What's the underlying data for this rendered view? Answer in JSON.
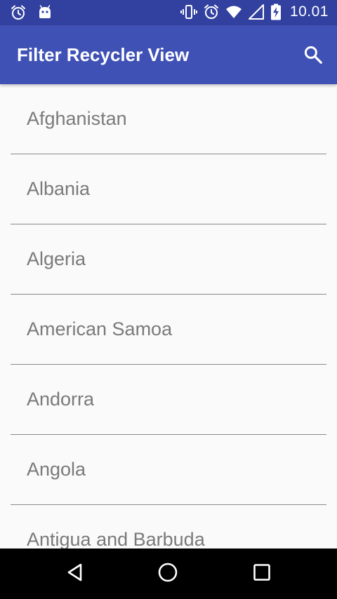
{
  "status_bar": {
    "time": "10.01",
    "left_icons": [
      "alarm-icon",
      "android-notification-icon"
    ],
    "right_icons": [
      "vibrate-icon",
      "alarm-icon",
      "wifi-icon",
      "signal-icon",
      "battery-charging-icon"
    ]
  },
  "app_bar": {
    "title": "Filter Recycler View",
    "search_icon": "search-icon",
    "color": "#3f51b5",
    "status_color": "#3241a0"
  },
  "list": {
    "items": [
      "Afghanistan",
      "Albania",
      "Algeria",
      "American Samoa",
      "Andorra",
      "Angola",
      "Antigua and Barbuda"
    ]
  },
  "nav_bar": {
    "buttons": [
      "back-icon",
      "home-icon",
      "recents-icon"
    ]
  }
}
